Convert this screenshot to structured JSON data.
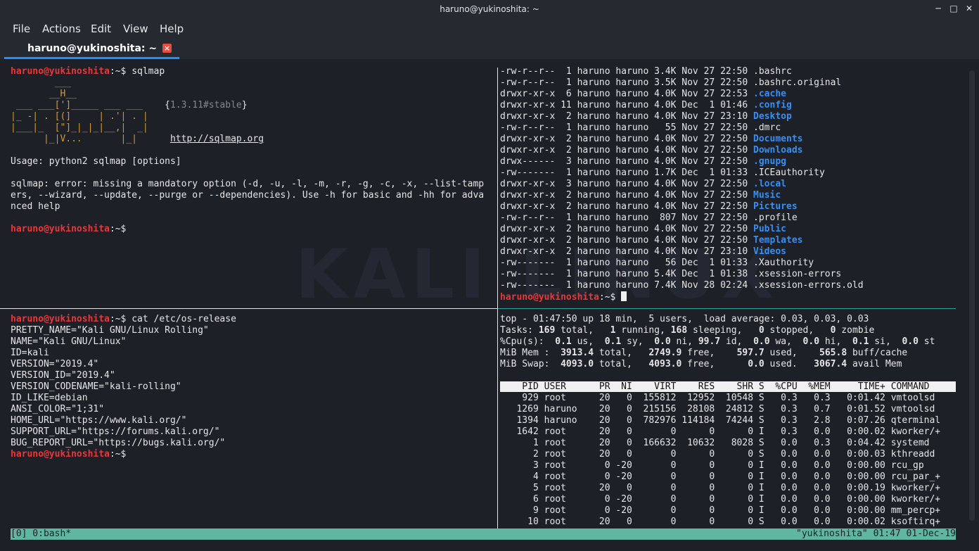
{
  "window": {
    "title": "haruno@yukinoshita: ~"
  },
  "menu": {
    "file": "File",
    "actions": "Actions",
    "edit": "Edit",
    "view": "View",
    "help": "Help"
  },
  "tab": {
    "label": "haruno@yukinoshita: ~"
  },
  "prompt": {
    "host": "haruno@yukinoshita",
    "suffix": ":~$"
  },
  "pane_sqlmap": {
    "command": " sqlmap",
    "banner": [
      "        ___",
      "       __H__",
      " ___ ___[']_____ ___ ___  ",
      "|_ -| . [(]     | .'| . |",
      "|___|_  [\"]_|_|_|__,|  _|",
      "      |_|V...       |_|   "
    ],
    "version": "1.3.11#stable",
    "url": "http://sqlmap.org",
    "usage": "Usage: python2 sqlmap [options]",
    "error_lines": [
      "sqlmap: error: missing a mandatory option (-d, -u, -l, -m, -r, -g, -c, -x, --list-tamp",
      "ers, --wizard, --update, --purge or --dependencies). Use -h for basic and -hh for adva",
      "nced help"
    ]
  },
  "pane_ls": {
    "rows": [
      {
        "perm": "-rw-r--r--",
        "links": "1",
        "user": "haruno",
        "group": "haruno",
        "size": "3.4K",
        "mon": "Nov",
        "day": "27",
        "time": "22:50",
        "name": ".bashrc",
        "dir": false
      },
      {
        "perm": "-rw-r--r--",
        "links": "1",
        "user": "haruno",
        "group": "haruno",
        "size": "3.5K",
        "mon": "Nov",
        "day": "27",
        "time": "22:50",
        "name": ".bashrc.original",
        "dir": false
      },
      {
        "perm": "drwxr-xr-x",
        "links": "6",
        "user": "haruno",
        "group": "haruno",
        "size": "4.0K",
        "mon": "Nov",
        "day": "27",
        "time": "22:53",
        "name": ".cache",
        "dir": true
      },
      {
        "perm": "drwxr-xr-x",
        "links": "11",
        "user": "haruno",
        "group": "haruno",
        "size": "4.0K",
        "mon": "Dec",
        "day": "1",
        "time": "01:46",
        "name": ".config",
        "dir": true
      },
      {
        "perm": "drwxr-xr-x",
        "links": "2",
        "user": "haruno",
        "group": "haruno",
        "size": "4.0K",
        "mon": "Nov",
        "day": "27",
        "time": "23:10",
        "name": "Desktop",
        "dir": true
      },
      {
        "perm": "-rw-r--r--",
        "links": "1",
        "user": "haruno",
        "group": "haruno",
        "size": "55",
        "mon": "Nov",
        "day": "27",
        "time": "22:50",
        "name": ".dmrc",
        "dir": false
      },
      {
        "perm": "drwxr-xr-x",
        "links": "2",
        "user": "haruno",
        "group": "haruno",
        "size": "4.0K",
        "mon": "Nov",
        "day": "27",
        "time": "22:50",
        "name": "Documents",
        "dir": true
      },
      {
        "perm": "drwxr-xr-x",
        "links": "2",
        "user": "haruno",
        "group": "haruno",
        "size": "4.0K",
        "mon": "Nov",
        "day": "27",
        "time": "22:50",
        "name": "Downloads",
        "dir": true
      },
      {
        "perm": "drwx------",
        "links": "3",
        "user": "haruno",
        "group": "haruno",
        "size": "4.0K",
        "mon": "Nov",
        "day": "27",
        "time": "22:50",
        "name": ".gnupg",
        "dir": true
      },
      {
        "perm": "-rw-------",
        "links": "1",
        "user": "haruno",
        "group": "haruno",
        "size": "1.7K",
        "mon": "Dec",
        "day": "1",
        "time": "01:33",
        "name": ".ICEauthority",
        "dir": false
      },
      {
        "perm": "drwxr-xr-x",
        "links": "3",
        "user": "haruno",
        "group": "haruno",
        "size": "4.0K",
        "mon": "Nov",
        "day": "27",
        "time": "22:50",
        "name": ".local",
        "dir": true
      },
      {
        "perm": "drwxr-xr-x",
        "links": "2",
        "user": "haruno",
        "group": "haruno",
        "size": "4.0K",
        "mon": "Nov",
        "day": "27",
        "time": "22:50",
        "name": "Music",
        "dir": true
      },
      {
        "perm": "drwxr-xr-x",
        "links": "2",
        "user": "haruno",
        "group": "haruno",
        "size": "4.0K",
        "mon": "Nov",
        "day": "27",
        "time": "22:50",
        "name": "Pictures",
        "dir": true
      },
      {
        "perm": "-rw-r--r--",
        "links": "1",
        "user": "haruno",
        "group": "haruno",
        "size": "807",
        "mon": "Nov",
        "day": "27",
        "time": "22:50",
        "name": ".profile",
        "dir": false
      },
      {
        "perm": "drwxr-xr-x",
        "links": "2",
        "user": "haruno",
        "group": "haruno",
        "size": "4.0K",
        "mon": "Nov",
        "day": "27",
        "time": "22:50",
        "name": "Public",
        "dir": true
      },
      {
        "perm": "drwxr-xr-x",
        "links": "2",
        "user": "haruno",
        "group": "haruno",
        "size": "4.0K",
        "mon": "Nov",
        "day": "27",
        "time": "22:50",
        "name": "Templates",
        "dir": true
      },
      {
        "perm": "drwxr-xr-x",
        "links": "2",
        "user": "haruno",
        "group": "haruno",
        "size": "4.0K",
        "mon": "Nov",
        "day": "27",
        "time": "23:10",
        "name": "Videos",
        "dir": true
      },
      {
        "perm": "-rw-------",
        "links": "1",
        "user": "haruno",
        "group": "haruno",
        "size": "56",
        "mon": "Dec",
        "day": "1",
        "time": "01:33",
        "name": ".Xauthority",
        "dir": false
      },
      {
        "perm": "-rw-------",
        "links": "1",
        "user": "haruno",
        "group": "haruno",
        "size": "5.4K",
        "mon": "Dec",
        "day": "1",
        "time": "01:38",
        "name": ".xsession-errors",
        "dir": false
      },
      {
        "perm": "-rw-------",
        "links": "1",
        "user": "haruno",
        "group": "haruno",
        "size": "7.4K",
        "mon": "Nov",
        "day": "28",
        "time": "02:24",
        "name": ".xsession-errors.old",
        "dir": false
      }
    ]
  },
  "pane_os": {
    "command": " cat /etc/os-release",
    "lines": [
      "PRETTY_NAME=\"Kali GNU/Linux Rolling\"",
      "NAME=\"Kali GNU/Linux\"",
      "ID=kali",
      "VERSION=\"2019.4\"",
      "VERSION_ID=\"2019.4\"",
      "VERSION_CODENAME=\"kali-rolling\"",
      "ID_LIKE=debian",
      "ANSI_COLOR=\"1;31\"",
      "HOME_URL=\"https://www.kali.org/\"",
      "SUPPORT_URL=\"https://forums.kali.org/\"",
      "BUG_REPORT_URL=\"https://bugs.kali.org/\""
    ]
  },
  "pane_top": {
    "summary": [
      [
        {
          "t": "top - 01:47:50 up 18 min,  5 users,  load average: 0.03, 0.03, 0.03"
        }
      ],
      [
        {
          "t": "Tasks: "
        },
        {
          "t": "169",
          "b": true
        },
        {
          "t": " total,   "
        },
        {
          "t": "1",
          "b": true
        },
        {
          "t": " running, "
        },
        {
          "t": "168",
          "b": true
        },
        {
          "t": " sleeping,   "
        },
        {
          "t": "0",
          "b": true
        },
        {
          "t": " stopped,   "
        },
        {
          "t": "0",
          "b": true
        },
        {
          "t": " zombie"
        }
      ],
      [
        {
          "t": "%Cpu(s):  "
        },
        {
          "t": "0.1",
          "b": true
        },
        {
          "t": " us,  "
        },
        {
          "t": "0.1",
          "b": true
        },
        {
          "t": " sy,  "
        },
        {
          "t": "0.0",
          "b": true
        },
        {
          "t": " ni, "
        },
        {
          "t": "99.7",
          "b": true
        },
        {
          "t": " id,  "
        },
        {
          "t": "0.0",
          "b": true
        },
        {
          "t": " wa,  "
        },
        {
          "t": "0.0",
          "b": true
        },
        {
          "t": " hi,  "
        },
        {
          "t": "0.1",
          "b": true
        },
        {
          "t": " si,  "
        },
        {
          "t": "0.0",
          "b": true
        },
        {
          "t": " st"
        }
      ],
      [
        {
          "t": "MiB Mem :  "
        },
        {
          "t": "3913.4",
          "b": true
        },
        {
          "t": " total,   "
        },
        {
          "t": "2749.9",
          "b": true
        },
        {
          "t": " free,    "
        },
        {
          "t": "597.7",
          "b": true
        },
        {
          "t": " used,    "
        },
        {
          "t": "565.8",
          "b": true
        },
        {
          "t": " buff/cache"
        }
      ],
      [
        {
          "t": "MiB Swap:  "
        },
        {
          "t": "4093.0",
          "b": true
        },
        {
          "t": " total,   "
        },
        {
          "t": "4093.0",
          "b": true
        },
        {
          "t": " free,      "
        },
        {
          "t": "0.0",
          "b": true
        },
        {
          "t": " used.   "
        },
        {
          "t": "3067.4",
          "b": true
        },
        {
          "t": " avail Mem"
        }
      ]
    ],
    "header": "    PID USER      PR  NI    VIRT    RES    SHR S  %CPU  %MEM     TIME+ COMMAND      ",
    "procs": [
      [
        "929",
        "root",
        "20",
        "0",
        "155812",
        "12952",
        "10548",
        "S",
        "0.3",
        "0.3",
        "0:01.42",
        "vmtoolsd"
      ],
      [
        "1269",
        "haruno",
        "20",
        "0",
        "215156",
        "28108",
        "24812",
        "S",
        "0.3",
        "0.7",
        "0:01.52",
        "vmtoolsd"
      ],
      [
        "1394",
        "haruno",
        "20",
        "0",
        "782976",
        "114184",
        "74244",
        "S",
        "0.3",
        "2.8",
        "0:07.26",
        "qterminal"
      ],
      [
        "1642",
        "root",
        "20",
        "0",
        "0",
        "0",
        "0",
        "I",
        "0.3",
        "0.0",
        "0:00.02",
        "kworker/+"
      ],
      [
        "1",
        "root",
        "20",
        "0",
        "166632",
        "10632",
        "8028",
        "S",
        "0.0",
        "0.3",
        "0:04.42",
        "systemd"
      ],
      [
        "2",
        "root",
        "20",
        "0",
        "0",
        "0",
        "0",
        "S",
        "0.0",
        "0.0",
        "0:00.03",
        "kthreadd"
      ],
      [
        "3",
        "root",
        "0",
        "-20",
        "0",
        "0",
        "0",
        "I",
        "0.0",
        "0.0",
        "0:00.00",
        "rcu_gp"
      ],
      [
        "4",
        "root",
        "0",
        "-20",
        "0",
        "0",
        "0",
        "I",
        "0.0",
        "0.0",
        "0:00.00",
        "rcu_par_+"
      ],
      [
        "5",
        "root",
        "20",
        "0",
        "0",
        "0",
        "0",
        "I",
        "0.0",
        "0.0",
        "0:00.19",
        "kworker/+"
      ],
      [
        "6",
        "root",
        "0",
        "-20",
        "0",
        "0",
        "0",
        "I",
        "0.0",
        "0.0",
        "0:00.00",
        "kworker/+"
      ],
      [
        "9",
        "root",
        "0",
        "-20",
        "0",
        "0",
        "0",
        "I",
        "0.0",
        "0.0",
        "0:00.00",
        "mm_percp+"
      ],
      [
        "10",
        "root",
        "20",
        "0",
        "0",
        "0",
        "0",
        "S",
        "0.0",
        "0.0",
        "0:00.02",
        "ksoftirq+"
      ]
    ]
  },
  "status": {
    "left": "[0] 0:bash*",
    "right": "\"yukinoshita\" 01:47 01-Dec-19"
  },
  "watermark": "KALI LINUX",
  "colors": {
    "prompt": "#e5383b",
    "directory": "#3b8eea",
    "statusbar": "#5fb7a1",
    "tab_underline": "#1e90ff"
  }
}
